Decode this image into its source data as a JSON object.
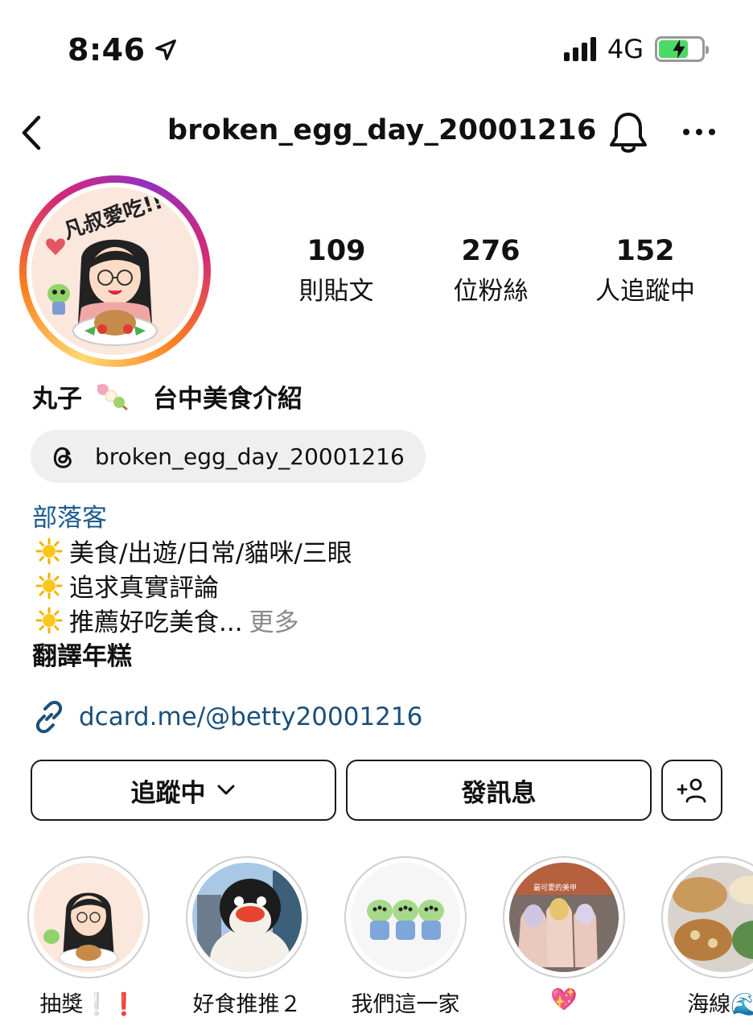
{
  "status_bar": {
    "time": "8:46",
    "network": "4G",
    "battery_color": "#4cd964"
  },
  "header": {
    "username": "broken_egg_day_20001216"
  },
  "stats": [
    {
      "num": "109",
      "label": "則貼文"
    },
    {
      "num": "276",
      "label": "位粉絲"
    },
    {
      "num": "152",
      "label": "人追蹤中"
    }
  ],
  "profile": {
    "display_name_left": "丸子",
    "display_name_right": "台中美食介紹",
    "avatar_text": "凡叔愛吃!!",
    "threads_handle": "broken_egg_day_20001216",
    "category": "部落客",
    "bio": [
      {
        "text": "美食/出遊/日常/貓咪/三眼"
      },
      {
        "text": "追求真實評論"
      },
      {
        "text": "推薦好吃美食...",
        "more": "更多"
      }
    ],
    "translate": "翻譯年糕",
    "link": "dcard.me/@betty20001216"
  },
  "buttons": {
    "following": "追蹤中",
    "message": "發訊息"
  },
  "highlights": [
    {
      "label": "抽獎❕❗"
    },
    {
      "label": "好食推推２"
    },
    {
      "label": "我們這一家"
    },
    {
      "label": "💖",
      "overlay_text": "最可愛的美甲"
    },
    {
      "label": "海線🌊"
    }
  ],
  "colors": {
    "link": "#1c4f7a",
    "category": "#1c5b8f",
    "sun": "#f5b301"
  }
}
